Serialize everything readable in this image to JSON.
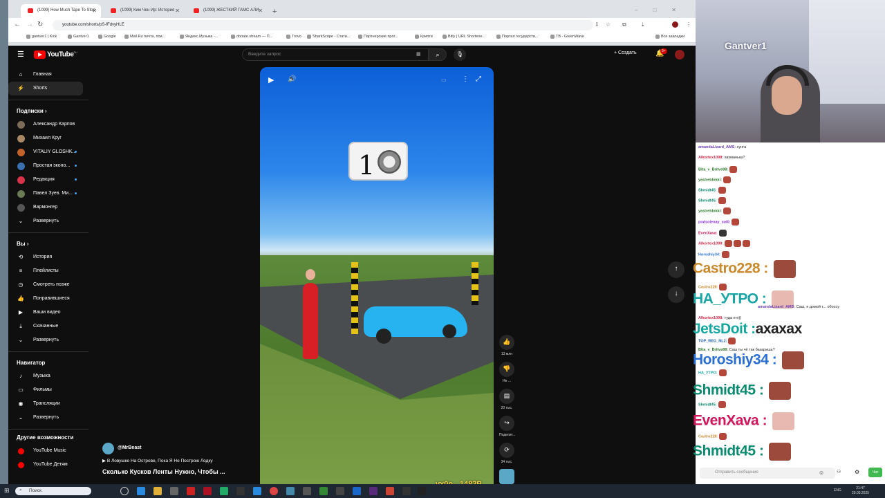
{
  "browser": {
    "tabs": [
      {
        "label": "(1099) How Much Tape To Stop"
      },
      {
        "label": "(1099) Ким Чен Ир: История"
      },
      {
        "label": "(1099) ЖЕСТКИЙ ГАМС АЛИ"
      }
    ],
    "url": "youtube.com/shorts/pS-fFdvyHLE",
    "bookmarks": [
      "gantver1 | Kick",
      "Gantver1",
      "Google",
      "Mail.Ru почта, пои...",
      "Яндекс.Музыка -...",
      "donate.stream — П...",
      "Trovo",
      "SharkScope - Стати...",
      "Партнерские прог...",
      "Крипта",
      "Bitly | URL Shortene...",
      "Портал государств...",
      "TB - GreenWave",
      "Все закладки"
    ]
  },
  "youtube": {
    "logo_text": "YouTube",
    "logo_sup": "RU",
    "search_placeholder": "Введите запрос",
    "create_label": "Создать",
    "notif_badge": "9+",
    "sidebar": {
      "main": [
        {
          "label": "Главная",
          "icon": "home-icon"
        },
        {
          "label": "Shorts",
          "icon": "shorts-icon"
        }
      ],
      "subs_header": "Подписки",
      "subs": [
        "Александр Карпов",
        "Михаил Круг",
        "VITALIY GLOSHK...",
        "Простая эконо...",
        "Редакция",
        "Павел Зуев. Ми...",
        "Вармонгер",
        "Развернуть"
      ],
      "you_header": "Вы",
      "you": [
        "История",
        "Плейлисты",
        "Смотреть позже",
        "Понравившиеся",
        "Ваши видео",
        "Скачанные",
        "Развернуть"
      ],
      "nav_header": "Навигатор",
      "nav": [
        "Музыка",
        "Фильмы",
        "Трансляции",
        "Развернуть"
      ],
      "more_header": "Другие возможности",
      "more": [
        "YouTube Music",
        "YouTube Детям"
      ]
    },
    "short": {
      "counter": "1",
      "channel": "@MrBeast",
      "suggestion": "В Ловушке На Острове, Пока Я Не Построю Лодку",
      "title": "Сколько Кусков Ленты Нужно, Чтобы ...",
      "likes": "13 млн",
      "dislike_label": "Не ...",
      "comments": "20 тыс.",
      "share_label": "Поделит...",
      "remix": "34 тыс."
    }
  },
  "stream": {
    "cam_name": "Gantver1",
    "overlay_text": "yx0o - 1483P",
    "chat": [
      {
        "user": "amandaLizard_AMS:",
        "text": "хунга",
        "color": "#6a3fb3"
      },
      {
        "user": "Alkortex1098:",
        "text": "хахманыш?",
        "color": "#e0294a"
      },
      {
        "user": "Bita_v_Britve88:",
        "text": "",
        "color": "#2d7a2d"
      },
      {
        "user": "yastreblokki:",
        "text": "",
        "color": "#2d7a2d"
      },
      {
        "user": "Shmidt45:",
        "text": "",
        "color": "#0a8a6f"
      },
      {
        "user": "Shmidt45:",
        "text": "",
        "color": "#0a8a6f"
      },
      {
        "user": "yastreblokki:",
        "text": "",
        "color": "#2d7a2d"
      },
      {
        "user": "podsolenay_sol0:",
        "text": "",
        "color": "#8a2be2"
      },
      {
        "user": "EvenXava:",
        "text": "",
        "color": "#d4145a"
      },
      {
        "user": "Alkortex1098:",
        "text": "",
        "color": "#e0294a"
      },
      {
        "user": "Horoshiy34:",
        "text": "",
        "color": "#2a6fd6"
      }
    ],
    "big": [
      {
        "user": "Castro228 :",
        "color": "#c98a2e"
      },
      {
        "user": "НА_УТРО :",
        "color": "#1aa5a5"
      },
      {
        "user": "JetsDoit :",
        "text": "ахахах",
        "color": "#13a89e"
      },
      {
        "user": "Horoshiy34 :",
        "color": "#2a6fd6"
      },
      {
        "user": "Shmidt45 :",
        "color": "#0a8a6f"
      },
      {
        "user": "EvenXava :",
        "color": "#d4145a"
      },
      {
        "user": "Shmidt45 :",
        "color": "#0a8a6f"
      }
    ],
    "chat_small": [
      {
        "user": "Castro228:",
        "text": ""
      },
      {
        "user": "amandaLizard_AMS:",
        "text": "Саш, я домой т... обоссу"
      },
      {
        "user": "Alkortex1098:",
        "text": "туда его))"
      },
      {
        "user": "TOP_REG_NL2:",
        "text": ""
      },
      {
        "user": "Bita_v_Britve88:",
        "text": "Саш ты чё так базаришь?"
      },
      {
        "user": "НА_УТРО:",
        "text": ""
      },
      {
        "user": "Shmidt45:",
        "text": ""
      },
      {
        "user": "Castro228:",
        "text": ""
      }
    ],
    "chat_input_placeholder": "Отправить сообщение",
    "chat_button": "Чат"
  },
  "taskbar": {
    "search": "Поиск",
    "lang": "ENG",
    "time": "21:47",
    "date": "29.03.2025"
  }
}
